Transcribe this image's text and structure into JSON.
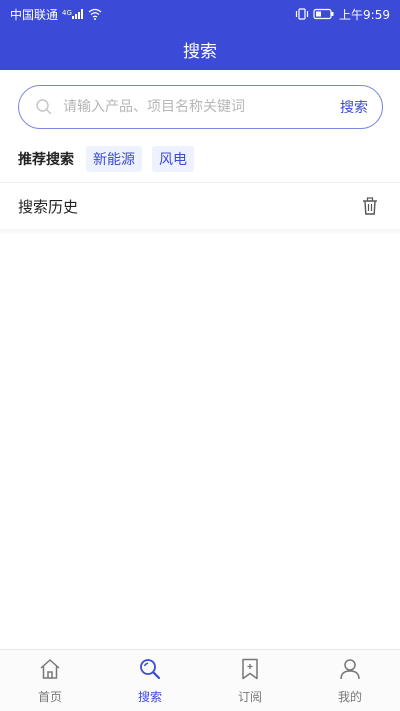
{
  "status_bar": {
    "carrier": "中国联通",
    "signal_label": "4G",
    "time": "上午9:59"
  },
  "header": {
    "title": "搜索"
  },
  "search": {
    "placeholder": "请输入产品、项目名称关键词",
    "button_label": "搜索"
  },
  "hot_search": {
    "title": "推荐搜索",
    "tags": [
      "新能源",
      "风电"
    ]
  },
  "history": {
    "title": "搜索历史"
  },
  "tabbar": {
    "items": [
      {
        "label": "首页",
        "icon": "home-icon",
        "active": false
      },
      {
        "label": "搜索",
        "icon": "search-icon",
        "active": true
      },
      {
        "label": "订阅",
        "icon": "bookmark-icon",
        "active": false
      },
      {
        "label": "我的",
        "icon": "user-icon",
        "active": false
      }
    ]
  },
  "colors": {
    "primary": "#3b4bd8",
    "tag_bg": "#eef2ff",
    "inactive": "#777777"
  }
}
